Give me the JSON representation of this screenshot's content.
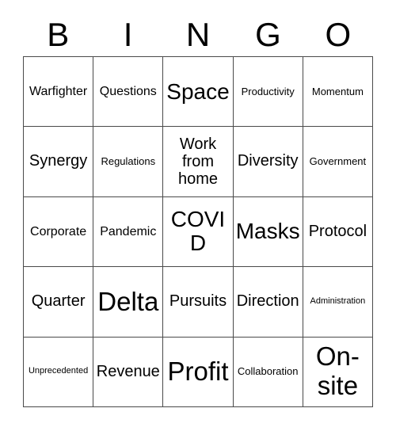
{
  "card": {
    "title_letters": [
      "B",
      "I",
      "N",
      "G",
      "O"
    ],
    "colors": {
      "grid_line": "#4a4a4a",
      "cell_background": "#ffffff",
      "text": "#000000",
      "page_background": "#ffffff"
    },
    "grid": {
      "rows": 5,
      "columns": 5,
      "cells": [
        [
          {
            "text": "Warfighter",
            "size": "sm"
          },
          {
            "text": "Questions",
            "size": "sm"
          },
          {
            "text": "Space",
            "size": "xl"
          },
          {
            "text": "Productivity",
            "size": "xs"
          },
          {
            "text": "Momentum",
            "size": "xs"
          }
        ],
        [
          {
            "text": "Synergy",
            "size": "md"
          },
          {
            "text": "Regulations",
            "size": "xs"
          },
          {
            "text": "Work from home",
            "size": "md",
            "multiline": true
          },
          {
            "text": "Diversity",
            "size": "md"
          },
          {
            "text": "Government",
            "size": "xs"
          }
        ],
        [
          {
            "text": "Corporate",
            "size": "sm"
          },
          {
            "text": "Pandemic",
            "size": "sm"
          },
          {
            "text": "COVID",
            "size": "xl"
          },
          {
            "text": "Masks",
            "size": "xl"
          },
          {
            "text": "Protocol",
            "size": "md"
          }
        ],
        [
          {
            "text": "Quarter",
            "size": "md"
          },
          {
            "text": "Delta",
            "size": "xxl"
          },
          {
            "text": "Pursuits",
            "size": "md"
          },
          {
            "text": "Direction",
            "size": "md"
          },
          {
            "text": "Administration",
            "size": "xxs"
          }
        ],
        [
          {
            "text": "Unprecedented",
            "size": "xxs"
          },
          {
            "text": "Revenue",
            "size": "md"
          },
          {
            "text": "Profit",
            "size": "xxl"
          },
          {
            "text": "Collaboration",
            "size": "xs"
          },
          {
            "text": "On-site",
            "size": "xxl",
            "multiline": true
          }
        ]
      ]
    }
  }
}
